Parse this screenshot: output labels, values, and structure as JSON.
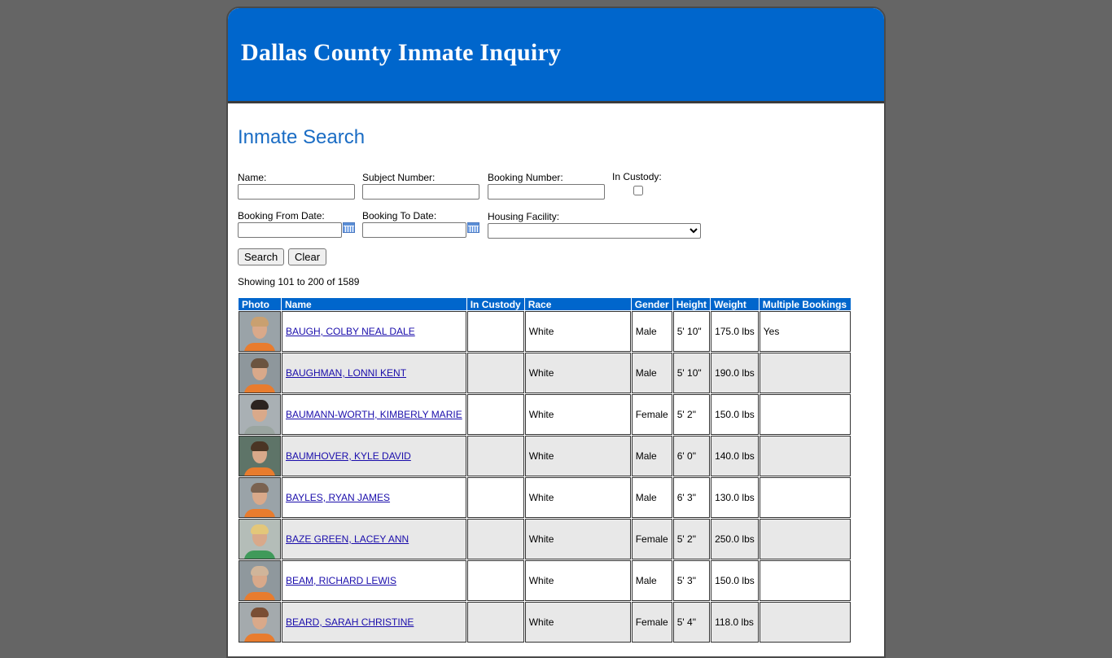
{
  "header": {
    "title": "Dallas County Inmate Inquiry"
  },
  "search": {
    "title": "Inmate Search",
    "name_label": "Name:",
    "subject_label": "Subject Number:",
    "booking_label": "Booking Number:",
    "custody_label": "In Custody:",
    "from_date_label": "Booking From Date:",
    "to_date_label": "Booking To Date:",
    "facility_label": "Housing Facility:",
    "search_button": "Search",
    "clear_button": "Clear"
  },
  "results": {
    "summary": "Showing 101 to 200 of 1589",
    "columns": [
      "Photo",
      "Name",
      "In Custody",
      "Race",
      "Gender",
      "Height",
      "Weight",
      "Multiple Bookings"
    ],
    "rows": [
      {
        "name": "BAUGH, COLBY NEAL DALE",
        "custody": "",
        "race": "White",
        "gender": "Male",
        "height": "5' 10\"",
        "weight": "175.0 lbs",
        "multiple": "Yes"
      },
      {
        "name": "BAUGHMAN, LONNI KENT",
        "custody": "",
        "race": "White",
        "gender": "Male",
        "height": "5' 10\"",
        "weight": "190.0 lbs",
        "multiple": ""
      },
      {
        "name": "BAUMANN-WORTH, KIMBERLY MARIE",
        "custody": "",
        "race": "White",
        "gender": "Female",
        "height": "5' 2\"",
        "weight": "150.0 lbs",
        "multiple": ""
      },
      {
        "name": "BAUMHOVER, KYLE DAVID",
        "custody": "",
        "race": "White",
        "gender": "Male",
        "height": "6' 0\"",
        "weight": "140.0 lbs",
        "multiple": ""
      },
      {
        "name": "BAYLES, RYAN JAMES",
        "custody": "",
        "race": "White",
        "gender": "Male",
        "height": "6' 3\"",
        "weight": "130.0 lbs",
        "multiple": ""
      },
      {
        "name": "BAZE GREEN, LACEY ANN",
        "custody": "",
        "race": "White",
        "gender": "Female",
        "height": "5' 2\"",
        "weight": "250.0 lbs",
        "multiple": ""
      },
      {
        "name": "BEAM, RICHARD LEWIS",
        "custody": "",
        "race": "White",
        "gender": "Male",
        "height": "5' 3\"",
        "weight": "150.0 lbs",
        "multiple": ""
      },
      {
        "name": "BEARD, SARAH CHRISTINE",
        "custody": "",
        "race": "White",
        "gender": "Female",
        "height": "5' 4\"",
        "weight": "118.0 lbs",
        "multiple": ""
      }
    ]
  },
  "photo_styles": [
    {
      "bg": "#9aa3a8",
      "shirt": "#e87c2e",
      "hair": "#c9a070"
    },
    {
      "bg": "#8e979c",
      "shirt": "#e87c2e",
      "hair": "#6b5440"
    },
    {
      "bg": "#a9b0b4",
      "shirt": "#9aa5a0",
      "hair": "#2b2320"
    },
    {
      "bg": "#5e7468",
      "shirt": "#e87c2e",
      "hair": "#4a3524"
    },
    {
      "bg": "#9aa3a8",
      "shirt": "#e87c2e",
      "hair": "#7a6250"
    },
    {
      "bg": "#b4bdb8",
      "shirt": "#3f9a5a",
      "hair": "#e3c77a"
    },
    {
      "bg": "#8f989d",
      "shirt": "#e87c2e",
      "hair": "#d0b59a"
    },
    {
      "bg": "#a4aaad",
      "shirt": "#e87c2e",
      "hair": "#7a4e34"
    }
  ],
  "colors": {
    "brand": "#0066cc",
    "background": "#656565",
    "link": "#1a0dab"
  }
}
